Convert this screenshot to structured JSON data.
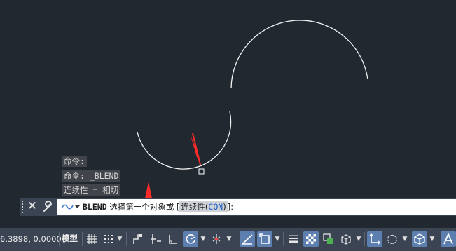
{
  "history": [
    "命令:",
    "命令: _BLEND",
    "连续性 = 相切"
  ],
  "command_line": {
    "command": "BLEND",
    "prompt_text": " 选择第一个对象或 [",
    "option_prefix": "连续性(",
    "option_keyword": "CON",
    "option_suffix": ")",
    "prompt_end": "]:"
  },
  "status_bar": {
    "coordinates": "6.3898, 0.0000",
    "model_label": "模型"
  },
  "colors": {
    "background": "#212830",
    "arrow": "#ff2a2a",
    "active_toggle": "#5d7fb0"
  }
}
